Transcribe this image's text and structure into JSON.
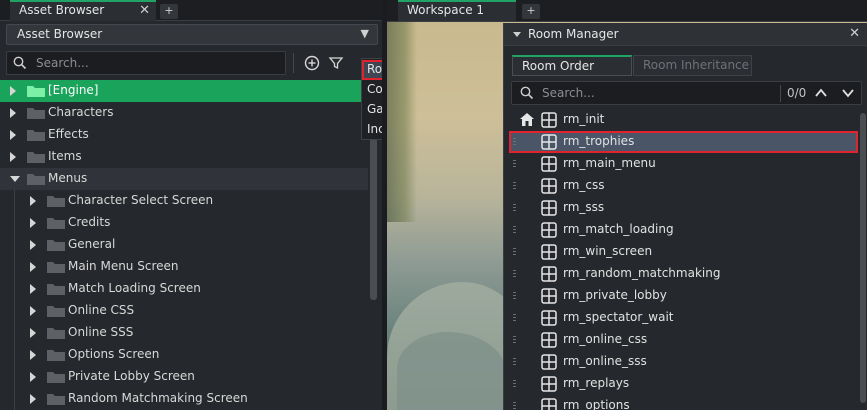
{
  "left_panel": {
    "tab_title": "Asset Browser",
    "tab_close": "✕",
    "tab_add": "+",
    "view_selector": "Asset Browser",
    "search_placeholder": "Search...",
    "tree": [
      {
        "label": "[Engine]",
        "depth": 0,
        "expanded": false,
        "selected": true
      },
      {
        "label": "Characters",
        "depth": 0,
        "expanded": false
      },
      {
        "label": "Effects",
        "depth": 0,
        "expanded": false
      },
      {
        "label": "Items",
        "depth": 0,
        "expanded": false
      },
      {
        "label": "Menus",
        "depth": 0,
        "expanded": true,
        "highlighted": true
      },
      {
        "label": "Character Select Screen",
        "depth": 1,
        "expanded": false
      },
      {
        "label": "Credits",
        "depth": 1,
        "expanded": false
      },
      {
        "label": "General",
        "depth": 1,
        "expanded": false
      },
      {
        "label": "Main Menu Screen",
        "depth": 1,
        "expanded": false
      },
      {
        "label": "Match Loading Screen",
        "depth": 1,
        "expanded": false
      },
      {
        "label": "Online CSS",
        "depth": 1,
        "expanded": false
      },
      {
        "label": "Online SSS",
        "depth": 1,
        "expanded": false
      },
      {
        "label": "Options Screen",
        "depth": 1,
        "expanded": false
      },
      {
        "label": "Private Lobby Screen",
        "depth": 1,
        "expanded": false
      },
      {
        "label": "Random Matchmaking Screen",
        "depth": 1,
        "expanded": false
      }
    ]
  },
  "context_menu": {
    "items": [
      {
        "label": "Room Manager",
        "highlighted": true
      },
      {
        "label": "Config Editor"
      },
      {
        "label": "Game Options"
      },
      {
        "label": "Included Files"
      }
    ]
  },
  "workspace": {
    "tab_title": "Workspace 1",
    "tab_add": "+"
  },
  "room_manager": {
    "title": "Room Manager",
    "close": "✕",
    "tabs": [
      {
        "label": "Room Order",
        "active": true
      },
      {
        "label": "Room Inheritance",
        "active": false
      }
    ],
    "search_placeholder": "Search...",
    "match_count": "0/0",
    "rooms": [
      {
        "name": "rm_init",
        "start_room": true
      },
      {
        "name": "rm_trophies",
        "selected": true
      },
      {
        "name": "rm_main_menu"
      },
      {
        "name": "rm_css"
      },
      {
        "name": "rm_sss"
      },
      {
        "name": "rm_match_loading"
      },
      {
        "name": "rm_win_screen"
      },
      {
        "name": "rm_random_matchmaking"
      },
      {
        "name": "rm_private_lobby"
      },
      {
        "name": "rm_spectator_wait"
      },
      {
        "name": "rm_online_css"
      },
      {
        "name": "rm_online_sss"
      },
      {
        "name": "rm_replays"
      },
      {
        "name": "rm_options"
      }
    ]
  },
  "colors": {
    "accent_green": "#1aa35a",
    "highlight_red": "#e0242f",
    "panel_bg": "#25282c"
  }
}
